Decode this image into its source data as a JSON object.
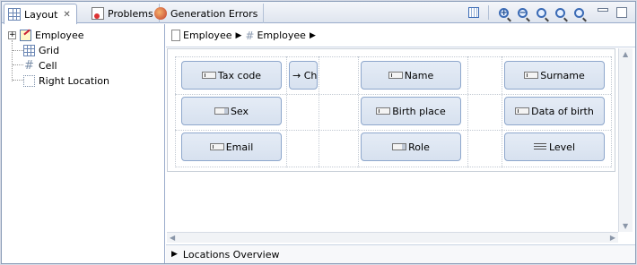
{
  "tabs": [
    {
      "label": "Layout",
      "icon": "layout-grid-icon",
      "active": true
    },
    {
      "label": "Problems",
      "icon": "problems-icon",
      "active": false
    },
    {
      "label": "Generation Errors",
      "icon": "generation-errors-icon",
      "active": false
    }
  ],
  "toolbar": {
    "icons": [
      "locate-icon",
      "zoom-in-icon",
      "zoom-out-icon",
      "zoom-fit-icon",
      "zoom-reset-icon",
      "zoom-area-icon"
    ],
    "zoom_in_glyph": "+",
    "zoom_out_glyph": "−"
  },
  "tree": {
    "items": [
      {
        "label": "Employee",
        "icon": "employee-form-icon"
      },
      {
        "label": "Grid",
        "icon": "grid-icon"
      },
      {
        "label": "Cell",
        "icon": "cell-icon"
      },
      {
        "label": "Right Location",
        "icon": "location-icon"
      }
    ],
    "expander": "+"
  },
  "breadcrumb": {
    "items": [
      {
        "label": "Employee",
        "icon": "document-icon"
      },
      {
        "label": "Employee",
        "icon": "hash-icon"
      }
    ]
  },
  "cells": [
    {
      "label": "Tax code",
      "icon": "text-field-icon"
    },
    {
      "label": "→ Ch",
      "icon": ""
    },
    {
      "label": "Name",
      "icon": "text-field-icon"
    },
    {
      "label": "Surname",
      "icon": "text-field-icon"
    },
    {
      "label": "Sex",
      "icon": "combo-box-icon"
    },
    {
      "label": "Birth place",
      "icon": "text-field-icon"
    },
    {
      "label": "Data of birth",
      "icon": "text-field-icon"
    },
    {
      "label": "Email",
      "icon": "text-field-icon"
    },
    {
      "label": "Role",
      "icon": "combo-box-icon"
    },
    {
      "label": "Level",
      "icon": "list-icon"
    }
  ],
  "overview": {
    "label": "Locations Overview"
  },
  "colors": {
    "accent": "#8ea7cc",
    "cell_bg": "#dfe7f2",
    "frame": "#8b9db8"
  }
}
